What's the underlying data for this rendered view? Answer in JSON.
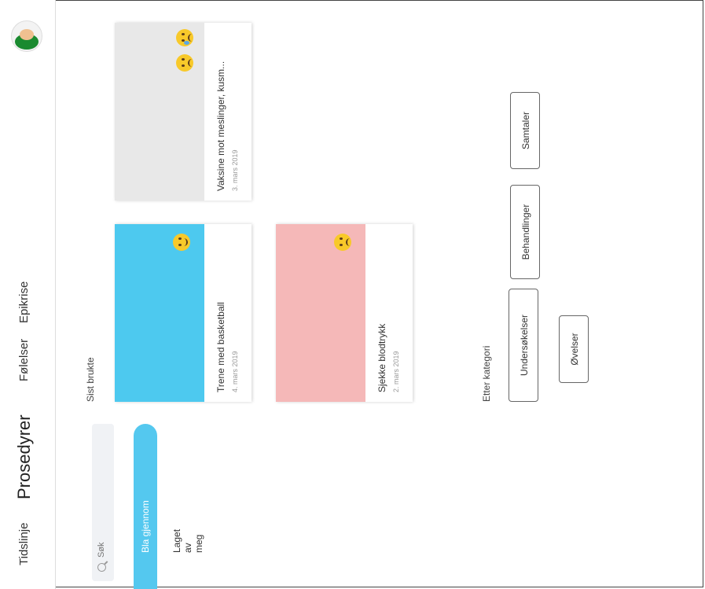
{
  "nav": {
    "items": [
      {
        "label": "Tidslinje"
      },
      {
        "label": "Prosedyrer"
      },
      {
        "label": "Følelser"
      },
      {
        "label": "Epikrise"
      }
    ]
  },
  "search": {
    "placeholder": "Søk"
  },
  "filters": {
    "bla_gjennom": "Bla gjennom",
    "laget_av_meg": "Laget av meg"
  },
  "recent": {
    "heading": "Sist brukte",
    "cards": [
      {
        "title": "Trene med basketball",
        "date": "4. mars 2019",
        "color": "#4dc9ef",
        "emojis": [
          "grin-squint-emoji"
        ]
      },
      {
        "title": "Sjekke blodtrykk",
        "date": "2. mars 2019",
        "color": "#f5b8b8",
        "emojis": [
          "worried-emoji"
        ]
      },
      {
        "title": "Vaksine mot meslinger, kusm...",
        "date": "3. mars 2019",
        "color": "#e8e8e8",
        "emojis": [
          "crying-emoji",
          "worried-emoji"
        ]
      }
    ]
  },
  "categories": {
    "heading": "Etter kategori",
    "items": [
      {
        "label": "Undersøkelser"
      },
      {
        "label": "Behandlinger"
      },
      {
        "label": "Samtaler"
      },
      {
        "label": "Øvelser"
      }
    ]
  }
}
